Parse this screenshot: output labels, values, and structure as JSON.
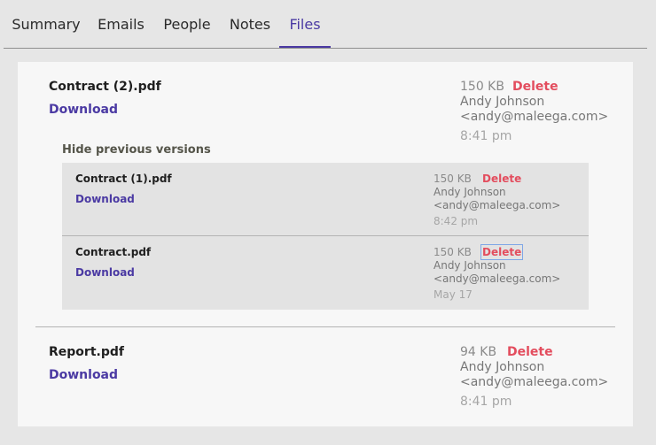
{
  "tabs": [
    {
      "label": "Summary"
    },
    {
      "label": "Emails"
    },
    {
      "label": "People"
    },
    {
      "label": "Notes"
    },
    {
      "label": "Files",
      "active": true
    }
  ],
  "files": [
    {
      "name": "Contract (2).pdf",
      "download_label": "Download",
      "size": "150 KB",
      "delete_label": "Delete",
      "author": "Andy Johnson",
      "email": "<andy@maleega.com>",
      "time": "8:41 pm",
      "versions_toggle": "Hide previous versions",
      "versions": [
        {
          "name": "Contract (1).pdf",
          "download_label": "Download",
          "size": "150 KB",
          "delete_label": "Delete",
          "author": "Andy Johnson",
          "email": "<andy@maleega.com>",
          "time": "8:42 pm"
        },
        {
          "name": "Contract.pdf",
          "download_label": "Download",
          "size": "150 KB",
          "delete_label": "Delete",
          "author": "Andy Johnson",
          "email": "<andy@maleega.com>",
          "time": "May 17"
        }
      ]
    },
    {
      "name": "Report.pdf",
      "download_label": "Download",
      "size": "94 KB",
      "delete_label": "Delete",
      "author": "Andy Johnson",
      "email": "<andy@maleega.com>",
      "time": "8:41 pm"
    }
  ],
  "colors": {
    "accent": "#4b3aa3",
    "delete": "#e34d5e",
    "background": "#e6e6e6",
    "panel": "#f7f7f7",
    "versions_bg": "#e3e3e3"
  }
}
